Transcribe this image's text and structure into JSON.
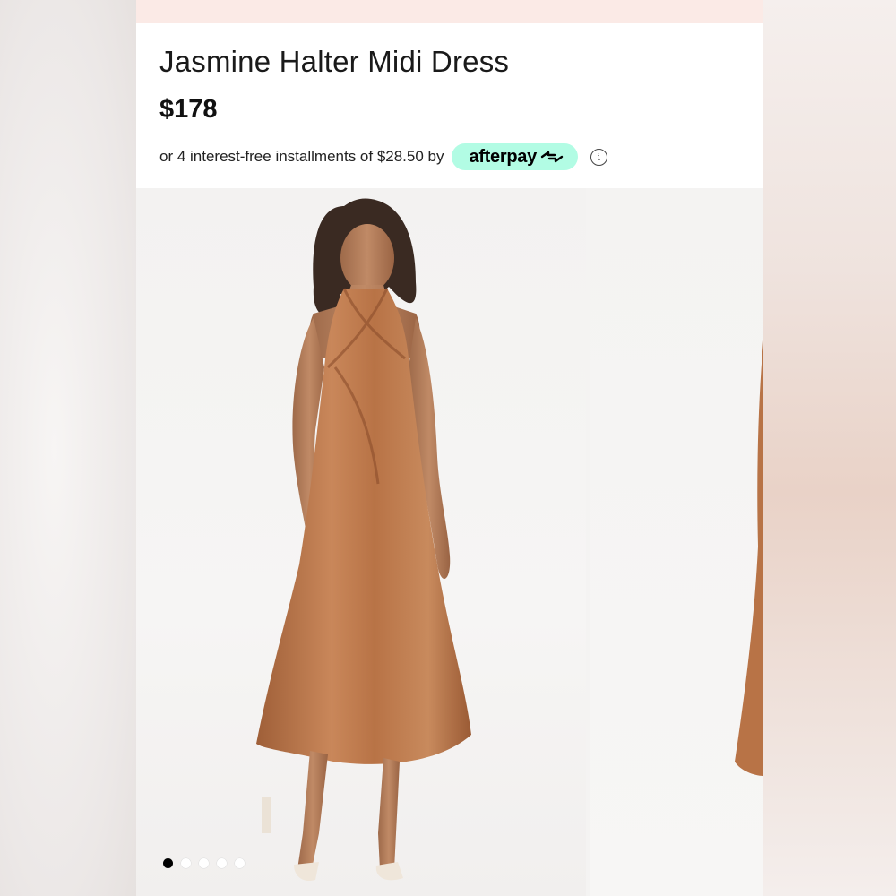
{
  "product": {
    "title": "Jasmine Halter Midi Dress",
    "price": "$178"
  },
  "payment": {
    "installments_text": "or 4 interest-free installments of $28.50 by",
    "provider_label": "afterpay",
    "provider_icon": "afterpay-arrows-icon",
    "info_icon": "info-icon",
    "badge_color": "#b2fce4"
  },
  "gallery": {
    "dot_count": 5,
    "active_index": 0,
    "dress_color": "#b9774c"
  }
}
